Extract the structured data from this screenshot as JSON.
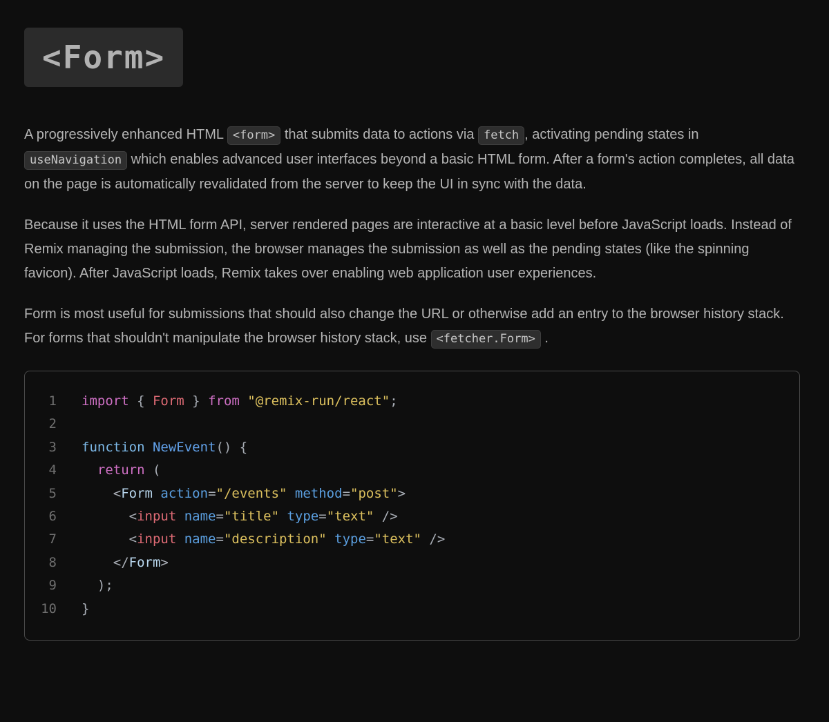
{
  "header": {
    "title": "<Form>"
  },
  "content": {
    "paragraphs": [
      {
        "segments": [
          {
            "type": "text",
            "text": "A progressively enhanced HTML "
          },
          {
            "type": "code",
            "text": "<form>"
          },
          {
            "type": "text",
            "text": " that submits data to actions via "
          },
          {
            "type": "code",
            "text": "fetch"
          },
          {
            "type": "text",
            "text": ", activating pending states in "
          },
          {
            "type": "code",
            "text": "useNavigation"
          },
          {
            "type": "text",
            "text": " which enables advanced user interfaces beyond a basic HTML form. After a form's action completes, all data on the page is automatically revalidated from the server to keep the UI in sync with the data."
          }
        ]
      },
      {
        "segments": [
          {
            "type": "text",
            "text": "Because it uses the HTML form API, server rendered pages are interactive at a basic level before JavaScript loads. Instead of Remix managing the submission, the browser manages the submission as well as the pending states (like the spinning favicon). After JavaScript loads, Remix takes over enabling web application user experiences."
          }
        ]
      },
      {
        "segments": [
          {
            "type": "text",
            "text": "Form is most useful for submissions that should also change the URL or otherwise add an entry to the browser history stack. For forms that shouldn't manipulate the browser history stack, use "
          },
          {
            "type": "code",
            "text": "<fetcher.Form>"
          },
          {
            "type": "text",
            "text": " ."
          }
        ]
      }
    ]
  },
  "code_block": {
    "language": "jsx",
    "lines": [
      {
        "number": "1",
        "tokens": [
          [
            "keyword",
            "import"
          ],
          [
            "plain",
            " { "
          ],
          [
            "entity",
            "Form"
          ],
          [
            "plain",
            " } "
          ],
          [
            "keyword",
            "from"
          ],
          [
            "plain",
            " "
          ],
          [
            "string",
            "\"@remix-run/react\""
          ],
          [
            "plain",
            ";"
          ]
        ]
      },
      {
        "number": "2",
        "tokens": []
      },
      {
        "number": "3",
        "tokens": [
          [
            "kw2",
            "function"
          ],
          [
            "plain",
            " "
          ],
          [
            "func",
            "NewEvent"
          ],
          [
            "plain",
            "() {"
          ]
        ]
      },
      {
        "number": "4",
        "tokens": [
          [
            "plain",
            "  "
          ],
          [
            "keyword",
            "return"
          ],
          [
            "plain",
            " ("
          ]
        ]
      },
      {
        "number": "5",
        "tokens": [
          [
            "plain",
            "    <"
          ],
          [
            "component",
            "Form"
          ],
          [
            "plain",
            " "
          ],
          [
            "attr",
            "action"
          ],
          [
            "plain",
            "="
          ],
          [
            "string",
            "\"/events\""
          ],
          [
            "plain",
            " "
          ],
          [
            "attr",
            "method"
          ],
          [
            "plain",
            "="
          ],
          [
            "string",
            "\"post\""
          ],
          [
            "plain",
            ">"
          ]
        ]
      },
      {
        "number": "6",
        "tokens": [
          [
            "plain",
            "      <"
          ],
          [
            "entity",
            "input"
          ],
          [
            "plain",
            " "
          ],
          [
            "attr",
            "name"
          ],
          [
            "plain",
            "="
          ],
          [
            "string",
            "\"title\""
          ],
          [
            "plain",
            " "
          ],
          [
            "attr",
            "type"
          ],
          [
            "plain",
            "="
          ],
          [
            "string",
            "\"text\""
          ],
          [
            "plain",
            " />"
          ]
        ]
      },
      {
        "number": "7",
        "tokens": [
          [
            "plain",
            "      <"
          ],
          [
            "entity",
            "input"
          ],
          [
            "plain",
            " "
          ],
          [
            "attr",
            "name"
          ],
          [
            "plain",
            "="
          ],
          [
            "string",
            "\"description\""
          ],
          [
            "plain",
            " "
          ],
          [
            "attr",
            "type"
          ],
          [
            "plain",
            "="
          ],
          [
            "string",
            "\"text\""
          ],
          [
            "plain",
            " />"
          ]
        ]
      },
      {
        "number": "8",
        "tokens": [
          [
            "plain",
            "    </"
          ],
          [
            "component",
            "Form"
          ],
          [
            "plain",
            ">"
          ]
        ]
      },
      {
        "number": "9",
        "tokens": [
          [
            "plain",
            "  );"
          ]
        ]
      },
      {
        "number": "10",
        "tokens": [
          [
            "plain",
            "}"
          ]
        ]
      }
    ]
  },
  "colors": {
    "bg": "#0e0e0e",
    "body_text": "#b4b4b4",
    "title_bg": "#2b2b2b",
    "title_text": "#b2b2b2",
    "chip_bg": "#2e2e2e",
    "chip_border": "#3e3e3e",
    "chip_text": "#c6c6c6",
    "code_border": "#4a4a4a",
    "line_num": "#6f6f6f",
    "tok_plain": "#a8adb5",
    "tok_keyword": "#cd6fc3",
    "tok_kw2": "#7db9e8",
    "tok_func": "#61a0e8",
    "tok_entity": "#df6b75",
    "tok_string": "#dcc05e",
    "tok_attr": "#5b9fe0",
    "tok_component": "#b9d7ee"
  }
}
